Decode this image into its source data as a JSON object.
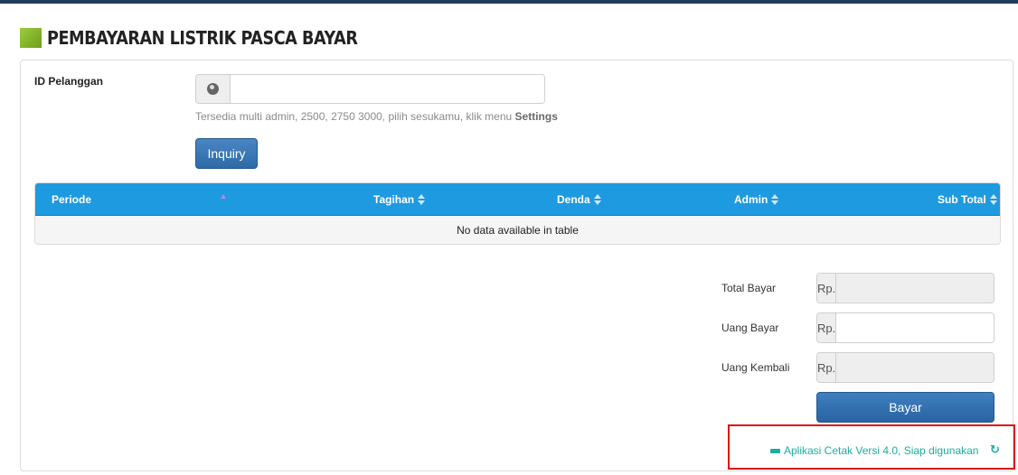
{
  "page": {
    "title": "PEMBAYARAN LISTRIK PASCA BAYAR"
  },
  "form": {
    "id_label": "ID Pelanggan",
    "id_value": "",
    "id_icon": "globe-icon",
    "help_text": "Tersedia multi admin, 2500, 2750 3000, pilih sesukamu, klik menu ",
    "help_bold": "Settings",
    "inquiry_label": "Inquiry"
  },
  "table": {
    "columns": [
      "Periode",
      "Tagihan",
      "Denda",
      "Admin",
      "Sub Total"
    ],
    "empty_text": "No data available in table",
    "header_color": "#1e9ae0"
  },
  "summary": {
    "currency": "Rp.",
    "total_label": "Total Bayar",
    "total_value": "",
    "uang_label": "Uang Bayar",
    "uang_value": "",
    "kembali_label": "Uang Kembali",
    "kembali_value": "",
    "bayar_label": "Bayar"
  },
  "status": {
    "text": "Aplikasi Cetak Versi 4.0, Siap digunakan",
    "print_icon": "printer-icon",
    "refresh_icon": "refresh-icon",
    "color": "#1aaea0",
    "highlight_color": "#e01010"
  }
}
